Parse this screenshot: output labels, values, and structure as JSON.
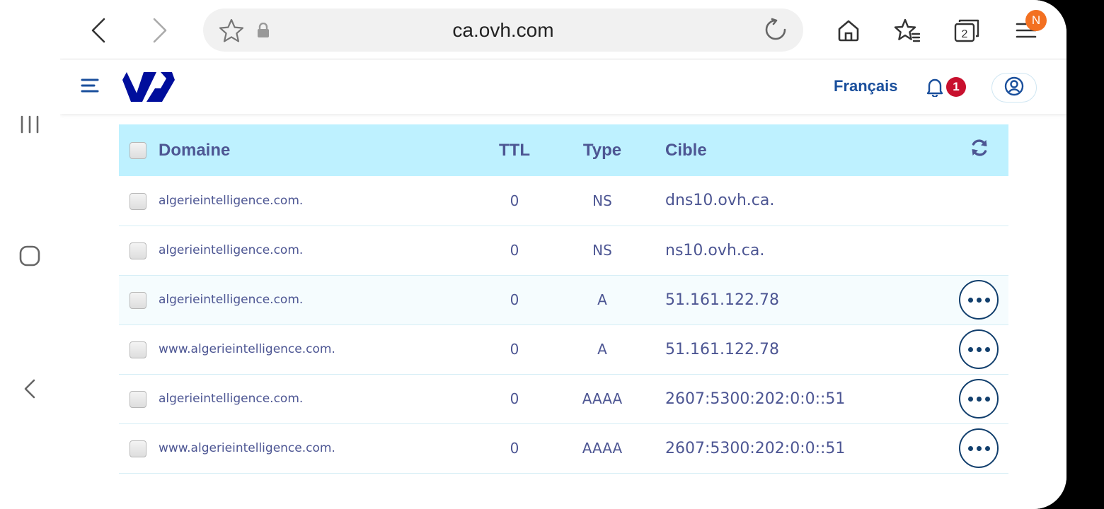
{
  "browser": {
    "url": "ca.ovh.com",
    "tab_count": "2",
    "profile_initial": "N"
  },
  "header": {
    "language_label": "Français",
    "notification_count": "1"
  },
  "table": {
    "headers": {
      "domain": "Domaine",
      "ttl": "TTL",
      "type": "Type",
      "target": "Cible"
    },
    "rows": [
      {
        "domain": "algerieintelligence.com.",
        "ttl": "0",
        "type": "NS",
        "target": "dns10.ovh.ca.",
        "actions": false
      },
      {
        "domain": "algerieintelligence.com.",
        "ttl": "0",
        "type": "NS",
        "target": "ns10.ovh.ca.",
        "actions": false
      },
      {
        "domain": "algerieintelligence.com.",
        "ttl": "0",
        "type": "A",
        "target": "51.161.122.78",
        "actions": true
      },
      {
        "domain": "www.algerieintelligence.com.",
        "ttl": "0",
        "type": "A",
        "target": "51.161.122.78",
        "actions": true
      },
      {
        "domain": "algerieintelligence.com.",
        "ttl": "0",
        "type": "AAAA",
        "target": "2607:5300:202:0:0::51",
        "actions": true
      },
      {
        "domain": "www.algerieintelligence.com.",
        "ttl": "0",
        "type": "AAAA",
        "target": "2607:5300:202:0:0::51",
        "actions": true
      }
    ]
  },
  "colors": {
    "table_header_bg": "#bef1ff",
    "text": "#4d5693",
    "brand": "#000e9c",
    "notification_badge": "#c8102e",
    "profile_badge": "#f37021"
  },
  "icons": [
    "recent-apps-icon",
    "home-icon",
    "back-icon",
    "chevron-left-icon",
    "chevron-right-icon",
    "star-icon",
    "lock-icon",
    "reload-icon",
    "browser-home-icon",
    "bookmarks-icon",
    "tabs-icon",
    "browser-menu-icon",
    "hamburger-menu-icon",
    "bell-icon",
    "user-icon",
    "refresh-icon",
    "more-icon"
  ]
}
